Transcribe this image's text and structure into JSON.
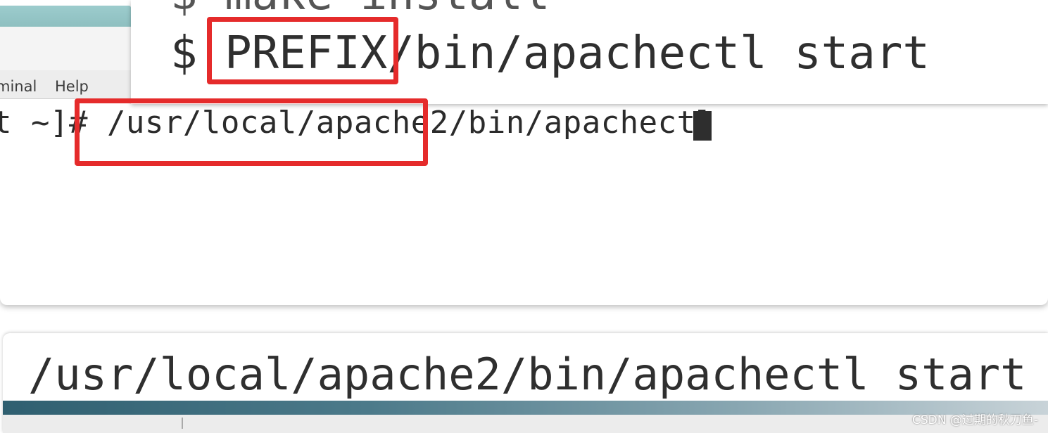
{
  "terminal": {
    "menu": {
      "terminal_label": "minal",
      "help_label": "Help"
    },
    "command_line": "t ~]# /usr/local/apache2/bin/apachectl"
  },
  "doc_snippet": {
    "partial_line": "$ make install",
    "main_line": "$ PREFIX/bin/apachectl start"
  },
  "bottom_snippet": {
    "command": "/usr/local/apache2/bin/apachectl start"
  },
  "watermark": "CSDN @过期的秋刀鱼-",
  "colors": {
    "highlight": "#e52b2b",
    "title_bar": "#9ccccd",
    "text": "#2f2f2f"
  }
}
